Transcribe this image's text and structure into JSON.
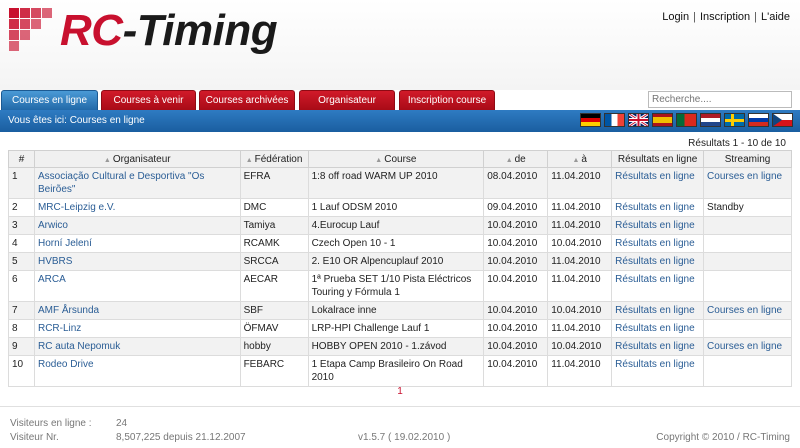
{
  "header": {
    "logo_rc": "RC",
    "logo_timing": "-Timing",
    "links": [
      "Login",
      "Inscription",
      "L'aide"
    ],
    "separator": "|"
  },
  "tabs": [
    {
      "label": "Courses en ligne",
      "active": true
    },
    {
      "label": "Courses à venir",
      "active": false
    },
    {
      "label": "Courses archivées",
      "active": false
    },
    {
      "label": "Organisateur",
      "active": false
    },
    {
      "label": "Inscription course",
      "active": false
    }
  ],
  "search": {
    "placeholder": "Recherche...."
  },
  "breadcrumb": "Vous êtes ici: Courses en ligne",
  "flags": [
    "germany-flag",
    "france-flag",
    "uk-flag",
    "spain-flag",
    "portugal-flag",
    "netherlands-flag",
    "sweden-flag",
    "russia-flag",
    "czech-flag"
  ],
  "results_label": "Résultats 1 - 10 de 10",
  "table": {
    "headers": [
      "#",
      "Organisateur",
      "Fédération",
      "Course",
      "de",
      "à",
      "Résultats en ligne",
      "Streaming"
    ],
    "rows": [
      {
        "n": "1",
        "org": "Associação Cultural e Desportiva \"Os Beirões\"",
        "fed": "EFRA",
        "course": "1:8 off road WARM UP 2010",
        "de": "08.04.2010",
        "a": "11.04.2010",
        "res": "Résultats en ligne",
        "stream": "Courses en ligne"
      },
      {
        "n": "2",
        "org": "MRC-Leipzig e.V.",
        "fed": "DMC",
        "course": "1 Lauf ODSM 2010",
        "de": "09.04.2010",
        "a": "11.04.2010",
        "res": "Résultats en ligne",
        "stream": "Standby"
      },
      {
        "n": "3",
        "org": "Arwico",
        "fed": "Tamiya",
        "course": "4.Eurocup Lauf",
        "de": "10.04.2010",
        "a": "11.04.2010",
        "res": "Résultats en ligne",
        "stream": ""
      },
      {
        "n": "4",
        "org": "Horní Jelení",
        "fed": "RCAMK",
        "course": "Czech Open 10 - 1",
        "de": "10.04.2010",
        "a": "10.04.2010",
        "res": "Résultats en ligne",
        "stream": ""
      },
      {
        "n": "5",
        "org": "HVBRS",
        "fed": "SRCCA",
        "course": "2. E10 OR Alpencuplauf 2010",
        "de": "10.04.2010",
        "a": "11.04.2010",
        "res": "Résultats en ligne",
        "stream": ""
      },
      {
        "n": "6",
        "org": "ARCA",
        "fed": "AECAR",
        "course": "1ª Prueba SET 1/10 Pista Eléctricos Touring y Fórmula 1",
        "de": "10.04.2010",
        "a": "11.04.2010",
        "res": "Résultats en ligne",
        "stream": ""
      },
      {
        "n": "7",
        "org": "AMF Årsunda",
        "fed": "SBF",
        "course": "Lokalrace inne",
        "de": "10.04.2010",
        "a": "10.04.2010",
        "res": "Résultats en ligne",
        "stream": "Courses en ligne"
      },
      {
        "n": "8",
        "org": "RCR-Linz",
        "fed": "ÖFMAV",
        "course": "LRP-HPI Challenge Lauf 1",
        "de": "10.04.2010",
        "a": "11.04.2010",
        "res": "Résultats en ligne",
        "stream": ""
      },
      {
        "n": "9",
        "org": "RC auta Nepomuk",
        "fed": "hobby",
        "course": "HOBBY OPEN 2010 - 1.závod",
        "de": "10.04.2010",
        "a": "10.04.2010",
        "res": "Résultats en ligne",
        "stream": "Courses en ligne"
      },
      {
        "n": "10",
        "org": "Rodeo Drive",
        "fed": "FEBARC",
        "course": "1 Etapa Camp Brasileiro On Road 2010",
        "de": "10.04.2010",
        "a": "11.04.2010",
        "res": "Résultats en ligne",
        "stream": ""
      }
    ]
  },
  "pager": "1",
  "footer": {
    "visitors_online_label": "Visiteurs en ligne :",
    "visitors_online_value": "24",
    "visitor_nr_label": "Visiteur Nr.",
    "visitor_nr_value": "8,507,225 depuis 21.12.2007",
    "version": "v1.5.7 ( 19.02.2010 )",
    "copyright": "Copyright © 2010 / RC-Timing"
  },
  "colors": {
    "brand_red": "#c8102e",
    "nav_blue": "#1a5ea0",
    "link": "#2a5d95"
  }
}
